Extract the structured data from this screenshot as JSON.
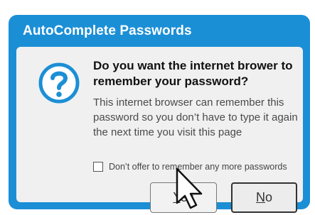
{
  "dialog": {
    "title": "AutoComplete Passwords",
    "heading": "Do you want the internet brower to remember your password?",
    "description": "This internet browser can remember this password so you don’t have to type it again the next time you visit this page",
    "checkbox": {
      "label": "Don’t offer to remember any more passwords",
      "checked": false
    },
    "buttons": {
      "yes_label": "Yes",
      "yes_mnemonic": "Y",
      "no_label": "No",
      "no_mnemonic": "N"
    }
  },
  "icons": {
    "help": "question-mark-icon",
    "pointer": "mouse-pointer-icon"
  },
  "colors": {
    "title_bar": "#1b8fd6",
    "body_bg": "#f0f0f0",
    "icon": "#1b8fd6"
  }
}
